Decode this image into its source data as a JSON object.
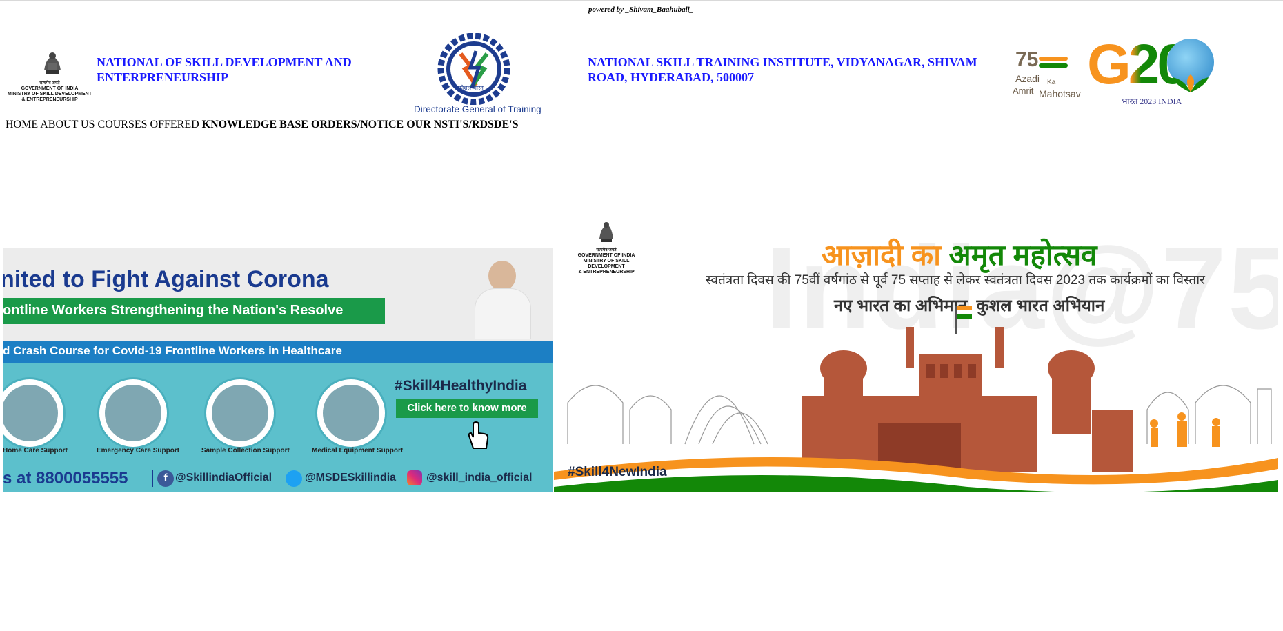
{
  "powered_by": "powered by _Shivam_Baahubali_",
  "header": {
    "left_title": [
      "NATIONAL OF SKILL DEVELOPMENT AND",
      "ENTERPRENEURSHIP"
    ],
    "right_title": [
      "NATIONAL SKILL TRAINING INSTITUTE, VIDYANAGAR, SHIVAM",
      "ROAD, HYDERABAD, 500007"
    ],
    "emblem_text": [
      "सत्यमेव जयते",
      "GOVERNMENT OF INDIA",
      "MINISTRY OF SKILL DEVELOPMENT",
      "& ENTREPRENEURSHIP"
    ],
    "dgt_caption": "Directorate General of Training",
    "dgt_hindi": "कौशल भारत",
    "azadi_text": [
      "Azadi",
      "Ka",
      "Amrit",
      "Mahotsav"
    ],
    "azadi_num": "75",
    "g20_text": "G20",
    "g20_sub": "भारत 2023 INDIA"
  },
  "nav": {
    "home": "HOME",
    "about": "ABOUT US",
    "courses": "COURSES OFFERED",
    "knowledge": "KNOWLEDGE BASE",
    "orders": "ORDERS/NOTICE",
    "nsti": "OUR NSTI'S/RDSDE'S"
  },
  "banner_left": {
    "headline": "nited to Fight Against Corona",
    "subline": "ontline Workers Strengthening the Nation's Resolve",
    "course_line": "d Crash Course for Covid-19 Frontline Workers in Healthcare",
    "hashtag": "#Skill4HealthyIndia",
    "cta": "Click here to know more",
    "circles": [
      "Home Care Support",
      "Emergency Care Support",
      "Sample Collection Support",
      "Medical Equipment Support"
    ],
    "footer_phone": "s at 8800055555",
    "social": [
      "@SkillindiaOfficial",
      "@MSDESkillindia",
      "@skill_india_official"
    ]
  },
  "banner_right": {
    "emblem_text": [
      "सत्यमेव जयते",
      "GOVERNMENT OF INDIA",
      "MINISTRY OF SKILL DEVELOPMENT",
      "& ENTREPRENEURSHIP"
    ],
    "title_orange": "आज़ादी का",
    "title_green": "अमृत महोत्सव",
    "line1": "स्वतंत्रता दिवस की 75वीं वर्षगांठ से पूर्व 75 सप्ताह से लेकर स्वतंत्रता दिवस 2023 तक कार्यक्रमों का विस्तार",
    "line2": "नए भारत का अभिमान, कुशल भारत अभियान",
    "watermark": "India@75",
    "hashtag": "#Skill4NewIndia"
  },
  "colors": {
    "blue_title": "#1a1aff",
    "saffron": "#f7931e",
    "green": "#138808",
    "teal": "#5cc0cc",
    "navy": "#1a3a8f",
    "fort": "#b5573a"
  }
}
